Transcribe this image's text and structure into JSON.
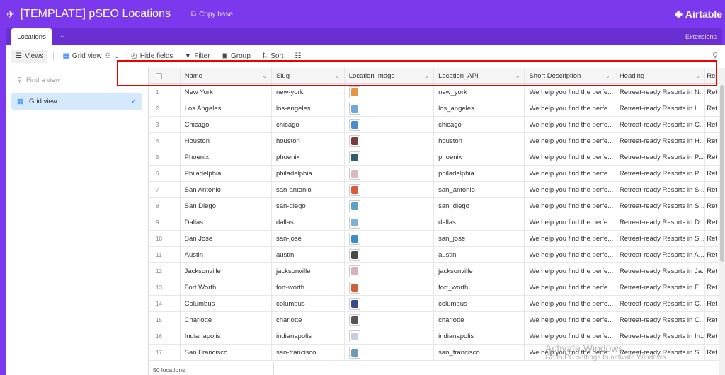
{
  "app": {
    "title": "[TEMPLATE] pSEO Locations",
    "copy_base": "Copy base",
    "brand": "Airtable",
    "brand_color": "#7b38ec"
  },
  "tabs": {
    "active": "Locations",
    "extensions": "Extensions"
  },
  "toolbar": {
    "views": "Views",
    "grid_view": "Grid view",
    "hide_fields": "Hide fields",
    "filter": "Filter",
    "group": "Group",
    "sort": "Sort"
  },
  "sidebar": {
    "find_placeholder": "Find a view",
    "items": [
      {
        "label": "Grid view",
        "selected": true
      }
    ]
  },
  "columns": [
    "Name",
    "Slug",
    "Location Image",
    "Location_API",
    "Short Description",
    "Heading",
    "Re"
  ],
  "rows": [
    {
      "n": "1",
      "name": "New York",
      "slug": "new-york",
      "img": "#e8934a",
      "api": "new_york",
      "desc": "We help you find the perfe...",
      "heading": "Retreat-ready Resorts in N...",
      "re": "Ret"
    },
    {
      "n": "2",
      "name": "Los Angeles",
      "slug": "los-angeles",
      "img": "#6fa8d8",
      "api": "los_angeles",
      "desc": "We help you find the perfe...",
      "heading": "Retreat-ready Resorts in L...",
      "re": "Ret"
    },
    {
      "n": "3",
      "name": "Chicago",
      "slug": "chicago",
      "img": "#4a8fc9",
      "api": "chicago",
      "desc": "We help you find the perfe...",
      "heading": "Retreat-ready Resorts in C...",
      "re": "Ret"
    },
    {
      "n": "4",
      "name": "Houston",
      "slug": "houston",
      "img": "#7a3b3b",
      "api": "houston",
      "desc": "We help you find the perfe...",
      "heading": "Retreat-ready Resorts in H...",
      "re": "Ret"
    },
    {
      "n": "5",
      "name": "Phoenix",
      "slug": "phoenix",
      "img": "#2f5f6f",
      "api": "phoenix",
      "desc": "We help you find the perfe...",
      "heading": "Retreat-ready Resorts in P...",
      "re": "Ret"
    },
    {
      "n": "6",
      "name": "Philadelphia",
      "slug": "philadelphia",
      "img": "#d9b8c0",
      "api": "philadelphia",
      "desc": "We help you find the perfe...",
      "heading": "Retreat-ready Resorts in P...",
      "re": "Ret"
    },
    {
      "n": "7",
      "name": "San Antonio",
      "slug": "san-antonio",
      "img": "#d95a3a",
      "api": "san_antonio",
      "desc": "We help you find the perfe...",
      "heading": "Retreat-ready Resorts in S...",
      "re": "Ret"
    },
    {
      "n": "8",
      "name": "San Diego",
      "slug": "san-diego",
      "img": "#5fa0c8",
      "api": "san_diego",
      "desc": "We help you find the perfe...",
      "heading": "Retreat-ready Resorts in S...",
      "re": "Ret"
    },
    {
      "n": "9",
      "name": "Dallas",
      "slug": "dallas",
      "img": "#7fb0d8",
      "api": "dallas",
      "desc": "We help you find the perfe...",
      "heading": "Retreat-ready Resorts in D...",
      "re": "Ret"
    },
    {
      "n": "10",
      "name": "San Jose",
      "slug": "san-jose",
      "img": "#3a8fc0",
      "api": "san_jose",
      "desc": "We help you find the perfe...",
      "heading": "Retreat-ready Resorts in S...",
      "re": "Ret"
    },
    {
      "n": "11",
      "name": "Austin",
      "slug": "austin",
      "img": "#4a4a4a",
      "api": "austin",
      "desc": "We help you find the perfe...",
      "heading": "Retreat-ready Resorts in A...",
      "re": "Ret"
    },
    {
      "n": "12",
      "name": "Jacksonville",
      "slug": "jacksonville",
      "img": "#d8b0b8",
      "api": "jacksonville",
      "desc": "We help you find the perfe...",
      "heading": "Retreat-ready Resorts in Ja...",
      "re": "Ret"
    },
    {
      "n": "13",
      "name": "Fort Worth",
      "slug": "fort-worth",
      "img": "#d0603a",
      "api": "fort_worth",
      "desc": "We help you find the perfe...",
      "heading": "Retreat-ready Resorts in F...",
      "re": "Ret"
    },
    {
      "n": "14",
      "name": "Columbus",
      "slug": "columbus",
      "img": "#3a4a8a",
      "api": "columbus",
      "desc": "We help you find the perfe...",
      "heading": "Retreat-ready Resorts in C...",
      "re": "Ret"
    },
    {
      "n": "15",
      "name": "Charlotte",
      "slug": "charlotte",
      "img": "#555555",
      "api": "charlotte",
      "desc": "We help you find the perfe...",
      "heading": "Retreat-ready Resorts in C...",
      "re": "Ret"
    },
    {
      "n": "16",
      "name": "Indianapolis",
      "slug": "indianapolis",
      "img": "#c8d0e0",
      "api": "indianapolis",
      "desc": "We help you find the perfe...",
      "heading": "Retreat-ready Resorts in In...",
      "re": "Ret"
    },
    {
      "n": "17",
      "name": "San Francisco",
      "slug": "san-francisco",
      "img": "#6a9ab8",
      "api": "san_francisco",
      "desc": "We help you find the perfe...",
      "heading": "Retreat-ready Resorts in S...",
      "re": "Ret"
    }
  ],
  "footer": {
    "count": "50 locations"
  },
  "watermark": {
    "line1": "Activate Windows",
    "line2": "Go to PC settings to activate Windows."
  }
}
